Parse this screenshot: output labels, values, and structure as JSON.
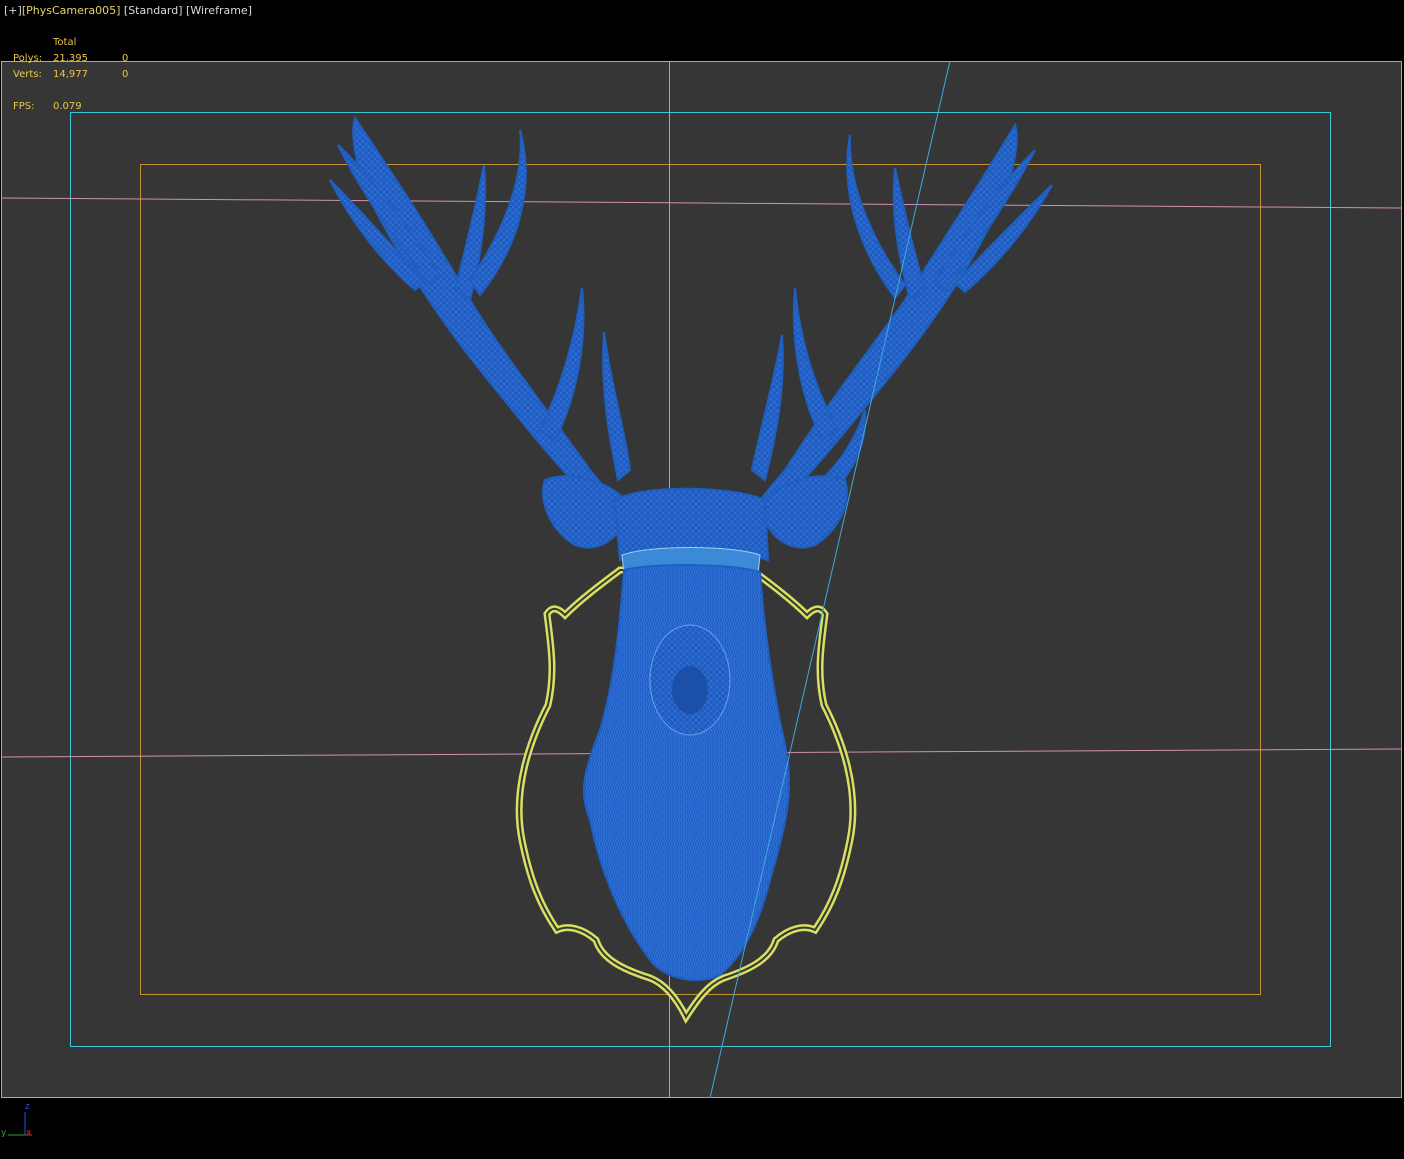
{
  "viewport": {
    "plus_label": "[+]",
    "camera_label": "[PhysCamera005]",
    "shading_label": "[Standard]",
    "mode_label": "[Wireframe]"
  },
  "stats": {
    "header": "Total",
    "polys_label": "Polys:",
    "polys_total": "21,395",
    "polys_selected": "0",
    "verts_label": "Verts:",
    "verts_total": "14,977",
    "verts_selected": "0",
    "fps_label": "FPS:",
    "fps_value": "0.079"
  },
  "gizmo": {
    "z": "z",
    "y": "y",
    "x": "x"
  },
  "colors": {
    "background": "#000000",
    "viewport_fill": "#363636",
    "frame_outer": "#c8b030",
    "safe_action": "#3ec8d8",
    "safe_title": "#c89030",
    "guide_lines": "#d090b0",
    "wireframe": "#1f5fc0",
    "plaque": "#d8e060",
    "camera_line": "#40a8e0",
    "label_text": "#e8c84a"
  },
  "scene": {
    "object": "deer-head-trophy",
    "plaque": "shield-plaque"
  }
}
